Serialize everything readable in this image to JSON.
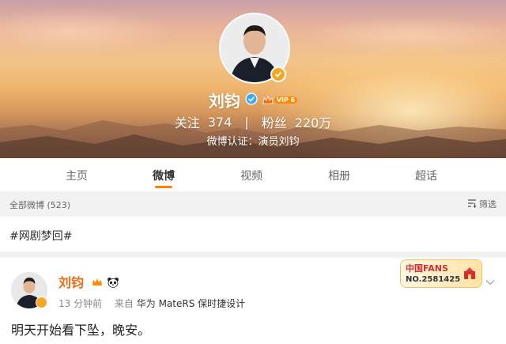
{
  "profile": {
    "name": "刘钧",
    "vip_label": "VIP 6",
    "following_label": "关注",
    "following_count": "374",
    "separator": "|",
    "fans_label": "粉丝",
    "fans_count": "220万",
    "certification": "微博认证：演员刘钧"
  },
  "tabs": [
    {
      "label": "主页",
      "active": false
    },
    {
      "label": "微博",
      "active": true
    },
    {
      "label": "视频",
      "active": false
    },
    {
      "label": "相册",
      "active": false
    },
    {
      "label": "超话",
      "active": false
    }
  ],
  "feed_bar": {
    "count_label": "全部微博 (523)",
    "filter_label": "筛选"
  },
  "topic": {
    "text": "#网剧梦回#"
  },
  "post": {
    "author": "刘钧",
    "time": "13 分钟前",
    "source_prefix": "来自",
    "device": "华为 MateRS 保时捷设计",
    "text": "明天开始看下坠，晚安。",
    "fans_badge_title": "中国FANS",
    "fans_badge_number": "NO.2581425"
  },
  "colors": {
    "accent": "#ff8200",
    "name_orange": "#e86b0f",
    "verified_gold": "#f5a623"
  },
  "icons": [
    "verified-icon",
    "blue-v-icon",
    "vip-crown-icon",
    "filter-icon",
    "panda-icon",
    "chevron-down-icon"
  ]
}
